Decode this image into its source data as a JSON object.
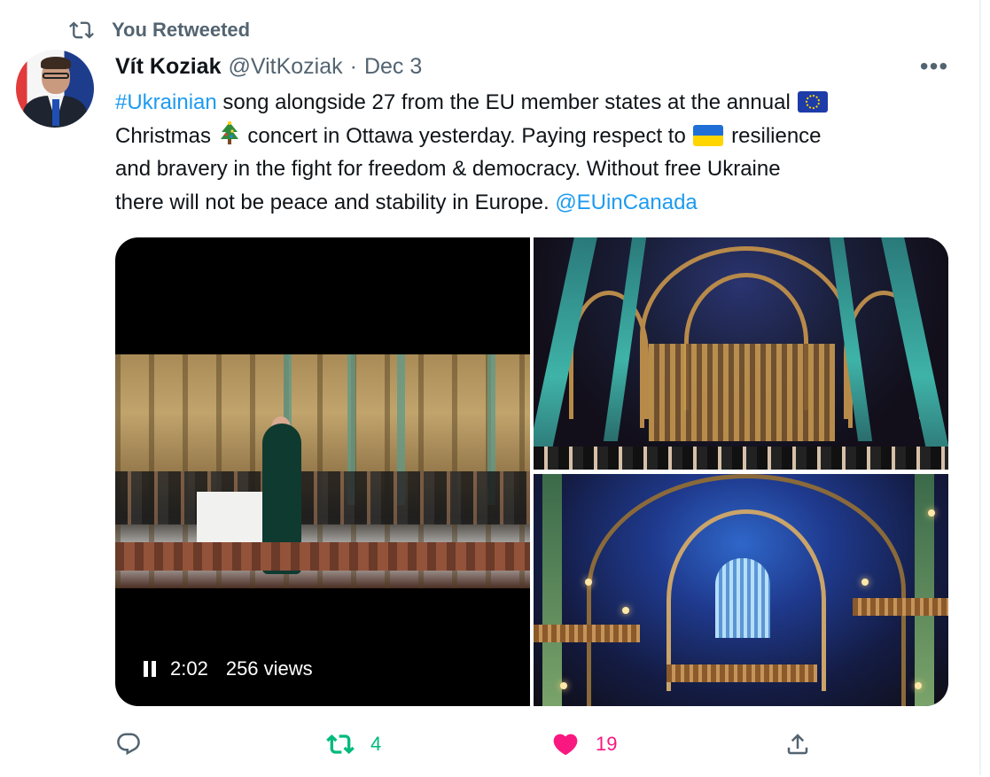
{
  "social_context": {
    "label": "You Retweeted",
    "icon": "retweet-icon"
  },
  "author": {
    "display_name": "Vít Koziak",
    "handle": "@VitKoziak",
    "separator": "·",
    "date": "Dec 3"
  },
  "more_button": {
    "label": "•••"
  },
  "tweet": {
    "hashtag": "#Ukrainian",
    "line1_text": " song alongside 27 from the EU member states at the annual ",
    "line2_a": "Christmas ",
    "line2_b": " concert in Ottawa yesterday. Paying respect to ",
    "line2_c": " resilience",
    "line3": "and bravery in the fight for freedom & democracy. Without free Ukraine",
    "line4": "there will not be peace and stability in Europe. ",
    "mention": "@EUinCanada",
    "emojis": [
      "eu-flag-icon",
      "christmas-tree-icon",
      "ukraine-flag-icon"
    ]
  },
  "media": {
    "video": {
      "time": "2:02",
      "views": "256 views",
      "state": "playing"
    },
    "photos": [
      "cathedral-nave-choir",
      "cathedral-organ-blue-vault"
    ]
  },
  "actions": {
    "reply_count": "",
    "retweet_count": "4",
    "like_count": "19",
    "share_label": ""
  },
  "colors": {
    "link": "#1d9bf0",
    "muted": "#536471",
    "retweet_active": "#00ba7c",
    "like_active": "#f91880",
    "text": "#0f1419"
  }
}
